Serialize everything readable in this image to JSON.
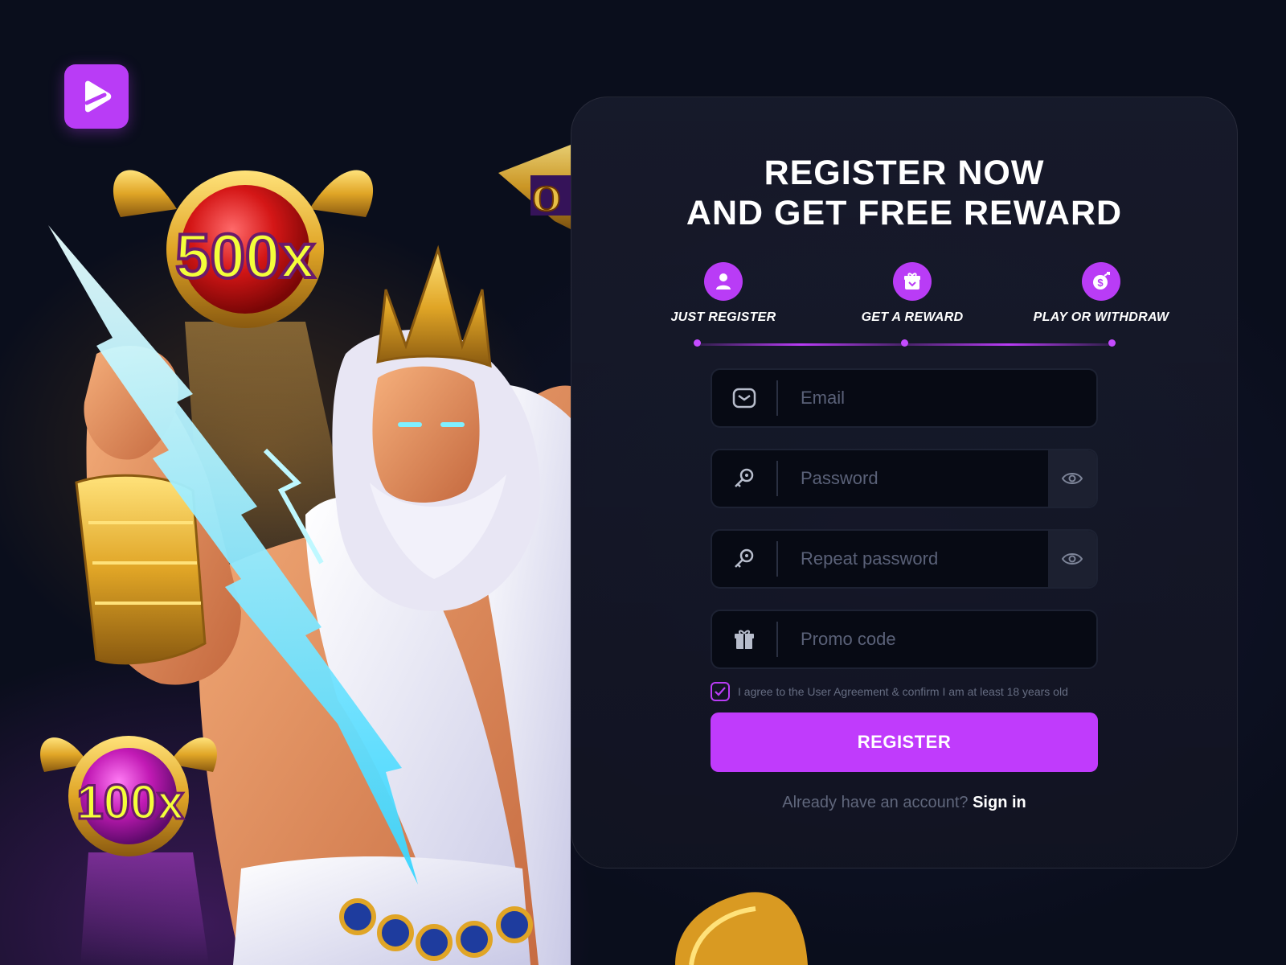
{
  "brand": {
    "accent": "#b93cf6",
    "logo_icon": "play-icon"
  },
  "artwork": {
    "badges": [
      "500x",
      "100x"
    ],
    "game_title_sign": "Gates of Olympus"
  },
  "register": {
    "title_line1": "REGISTER NOW",
    "title_line2": "AND GET FREE REWARD",
    "steps": [
      {
        "label": "JUST REGISTER",
        "icon": "user-icon"
      },
      {
        "label": "GET A REWARD",
        "icon": "gift-box-icon"
      },
      {
        "label": "PLAY OR WITHDRAW",
        "icon": "money-icon"
      }
    ],
    "email": {
      "placeholder": "Email",
      "value": ""
    },
    "password": {
      "placeholder": "Password",
      "value": ""
    },
    "repeat_password": {
      "placeholder": "Repeat password",
      "value": ""
    },
    "promo": {
      "placeholder": "Promo code",
      "value": ""
    },
    "agreement_text": "I agree to the User Agreement & confirm I am at least 18 years old",
    "agreement_checked": true,
    "submit_label": "REGISTER",
    "have_account_text": "Already have an account?",
    "signin_label": "Sign in"
  }
}
